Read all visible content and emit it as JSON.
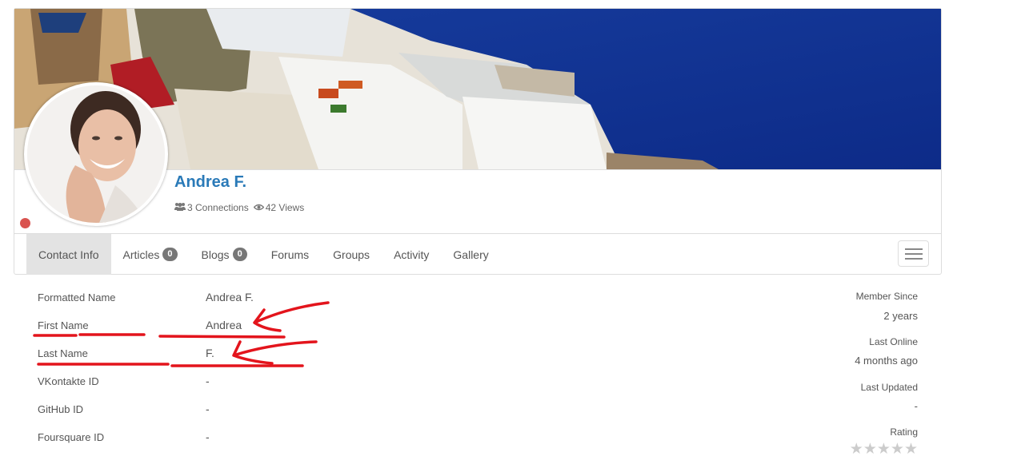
{
  "profile": {
    "name": "Andrea F.",
    "status": "offline",
    "status_color": "#d9534f",
    "name_color": "#2a7ab8",
    "stats": {
      "connections_label": "3 Connections",
      "views_label": "42 Views",
      "connections_icon": "users-icon",
      "views_icon": "eye-icon"
    },
    "cover_description": "Santorini whitewashed buildings above deep blue sea",
    "avatar_description": "Smiling woman with dark hair"
  },
  "tabs": [
    {
      "label": "Contact Info",
      "active": true
    },
    {
      "label": "Articles",
      "badge": "0"
    },
    {
      "label": "Blogs",
      "badge": "0"
    },
    {
      "label": "Forums"
    },
    {
      "label": "Groups"
    },
    {
      "label": "Activity"
    },
    {
      "label": "Gallery"
    }
  ],
  "menu_toggle_icon": "hamburger-icon",
  "contact_info": [
    {
      "label": "Formatted Name",
      "value": "Andrea F."
    },
    {
      "label": "First Name",
      "value": "Andrea"
    },
    {
      "label": "Last Name",
      "value": "F."
    },
    {
      "label": "VKontakte ID",
      "value": "-"
    },
    {
      "label": "GitHub ID",
      "value": "-"
    },
    {
      "label": "Foursquare ID",
      "value": "-"
    }
  ],
  "meta": {
    "member_since_label": "Member Since",
    "member_since_value": "2 years",
    "last_online_label": "Last Online",
    "last_online_value": "4 months ago",
    "last_updated_label": "Last Updated",
    "last_updated_value": "-",
    "rating_label": "Rating",
    "rating_value": 0,
    "rating_max": 5
  },
  "annotation_color": "#e3141c"
}
